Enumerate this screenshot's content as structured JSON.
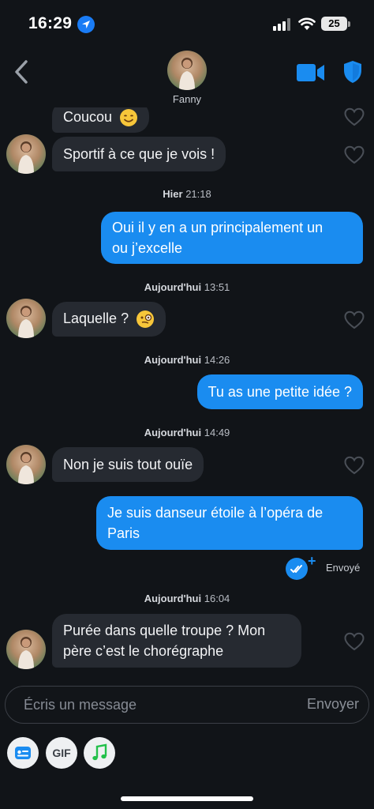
{
  "status_bar": {
    "time": "16:29",
    "battery": "25"
  },
  "header": {
    "contact_name": "Fanny"
  },
  "messages": {
    "m0": {
      "text": "Coucou"
    },
    "m1": {
      "text": "Sportif à ce que je vois !"
    },
    "sep1": {
      "day": "Hier",
      "time": "21:18"
    },
    "m2": {
      "line1": "Oui il y en a un principalement un",
      "line2": "ou j’excelle"
    },
    "sep2": {
      "day": "Aujourd'hui",
      "time": "13:51"
    },
    "m3": {
      "text": "Laquelle ?"
    },
    "sep3": {
      "day": "Aujourd'hui",
      "time": "14:26"
    },
    "m4": {
      "text": "Tu as une petite idée ?"
    },
    "sep4": {
      "day": "Aujourd'hui",
      "time": "14:49"
    },
    "m5": {
      "text": "Non je suis tout ouïe"
    },
    "m6": {
      "line1": "Je suis danseur étoile à l’opéra de",
      "line2": "Paris"
    },
    "sent_status": "Envoyé",
    "sep5": {
      "day": "Aujourd'hui",
      "time": "16:04"
    },
    "m7": {
      "line1": "Purée dans quelle troupe ? Mon",
      "line2": "père c’est le chorégraphe"
    }
  },
  "composer": {
    "placeholder": "Écris un message",
    "send_label": "Envoyer"
  },
  "actions": {
    "gif_label": "GIF"
  },
  "colors": {
    "accent": "#1a8cf0",
    "background": "#111418",
    "incoming_bubble": "#262a31"
  },
  "icons": [
    "back-icon",
    "video-camera-icon",
    "shield-icon",
    "heart-icon",
    "read-receipt-icon",
    "contact-card-icon",
    "music-note-icon"
  ]
}
